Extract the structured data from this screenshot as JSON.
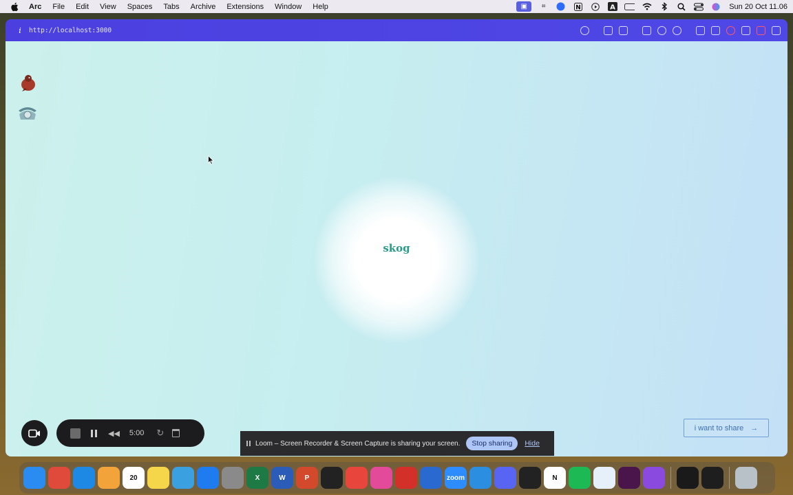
{
  "menubar": {
    "app": "Arc",
    "items": [
      "File",
      "Edit",
      "View",
      "Spaces",
      "Tabs",
      "Archive",
      "Extensions",
      "Window",
      "Help"
    ],
    "status_icons": [
      "screen-share-icon",
      "grid-icon",
      "zoom-status-icon",
      "notion-status-icon",
      "play-icon",
      "text-a-icon",
      "battery-icon",
      "wifi-icon",
      "bluetooth-icon",
      "search-icon",
      "control-center-icon",
      "siri-icon"
    ],
    "clock": "Sun 20 Oct  11.06"
  },
  "browser": {
    "url": "http://localhost:3000",
    "accent": "#4b3fe0",
    "tools": [
      "link-icon",
      "screenshot-icon",
      "camera-icon",
      "folder-icon",
      "globe-icon",
      "crosshair-icon",
      "code-icon",
      "pen-icon",
      "record-icon",
      "device-icon",
      "stop-icon",
      "sidebar-icon"
    ]
  },
  "page": {
    "logo_text": "skog",
    "share_button": "i want to share",
    "share_arrow": "→"
  },
  "loom": {
    "timer": "5:00"
  },
  "sharing_banner": {
    "message": "Loom – Screen Recorder & Screen Capture is sharing your screen.",
    "stop_label": "Stop sharing",
    "hide_label": "Hide"
  },
  "dock": {
    "apps": [
      {
        "name": "finder",
        "color": "#2a8cf0"
      },
      {
        "name": "launchpad",
        "color": "#e04a3a"
      },
      {
        "name": "safari",
        "color": "#1e88e5"
      },
      {
        "name": "photos",
        "color": "#f2a33a"
      },
      {
        "name": "calendar",
        "color": "#ffffff",
        "label": "20",
        "badge_month": "OCT"
      },
      {
        "name": "notes",
        "color": "#f5d64a"
      },
      {
        "name": "freeform",
        "color": "#3aa0e0"
      },
      {
        "name": "app-store",
        "color": "#1e7cf0"
      },
      {
        "name": "system-settings",
        "color": "#8a8a8a"
      },
      {
        "name": "excel",
        "color": "#1d7a45",
        "label": "X"
      },
      {
        "name": "word",
        "color": "#2b5db8",
        "label": "W"
      },
      {
        "name": "powerpoint",
        "color": "#d24a2b",
        "label": "P"
      },
      {
        "name": "activity-monitor",
        "color": "#222222"
      },
      {
        "name": "chrome",
        "color": "#e8453c"
      },
      {
        "name": "pixelmator",
        "color": "#e44a9a"
      },
      {
        "name": "acrobat",
        "color": "#d3302a"
      },
      {
        "name": "proxyman",
        "color": "#2a6ad0"
      },
      {
        "name": "zoom",
        "color": "#2d8cff",
        "label": "zoom"
      },
      {
        "name": "vscode",
        "color": "#2b8ee0"
      },
      {
        "name": "discord",
        "color": "#5865f2"
      },
      {
        "name": "unity",
        "color": "#222222"
      },
      {
        "name": "notion",
        "color": "#ffffff",
        "label": "N"
      },
      {
        "name": "spotify",
        "color": "#1db954"
      },
      {
        "name": "tableau",
        "color": "#e6f0fa"
      },
      {
        "name": "slack",
        "color": "#4a154b"
      },
      {
        "name": "arc",
        "color": "#8a4ae0"
      },
      {
        "name": "terminal",
        "color": "#1a1a1a"
      },
      {
        "name": "figma",
        "color": "#1e1e1e"
      },
      {
        "name": "trash",
        "color": "#b8c0c8"
      }
    ]
  }
}
